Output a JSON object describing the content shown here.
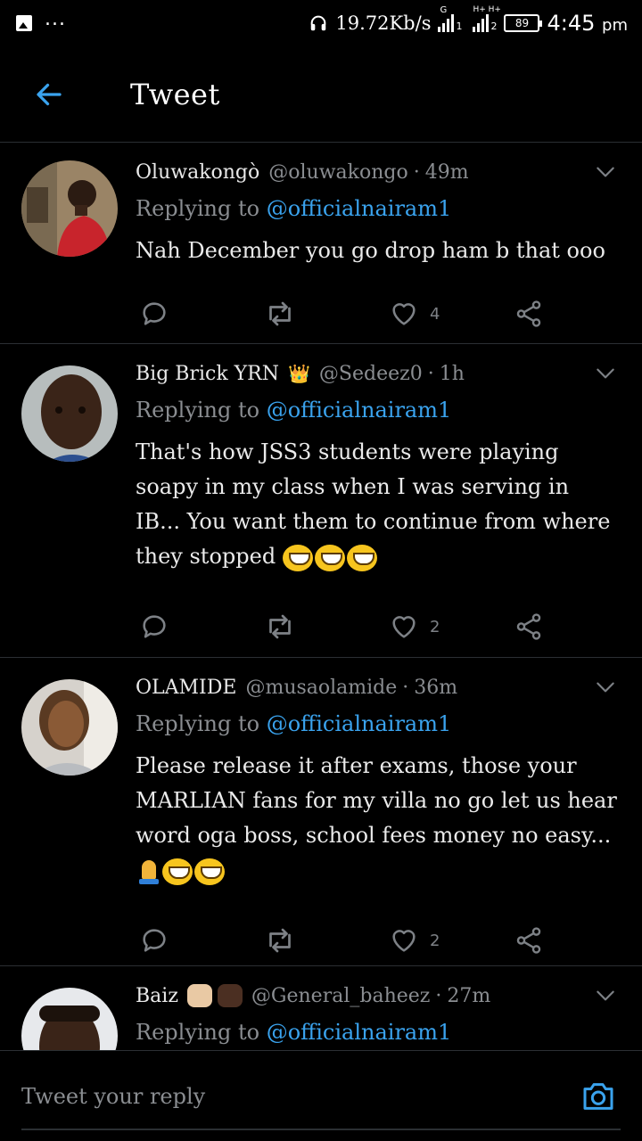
{
  "status_bar": {
    "net_speed": "19.72Kb/s",
    "sim1_label": "G",
    "sim1_index": "1",
    "sim2_label": "H+ H+",
    "sim2_index": "2",
    "battery": "89",
    "time": "4:45",
    "ampm": "pm",
    "icons": [
      "image-icon",
      "more-dots-icon",
      "headphones-icon",
      "signal-icon",
      "battery-icon"
    ]
  },
  "header": {
    "title": "Tweet",
    "back_icon": "arrow-left-icon"
  },
  "tweets": [
    {
      "name": "Oluwakongò",
      "name_emoji": "",
      "handle": "@oluwakongo",
      "time": "49m",
      "replying_prefix": "Replying to",
      "replying_handle": "@officialnairam1",
      "text": "Nah December you go drop ham b that ooo",
      "reply_count": "",
      "retweet_count": "",
      "like_count": "4"
    },
    {
      "name": "Big Brick YRN",
      "name_emoji": "👑",
      "handle": "@Sedeez0",
      "time": "1h",
      "replying_prefix": "Replying to",
      "replying_handle": "@officialnairam1",
      "text": "That's how JSS3 students were playing soapy in my class when I was serving in IB... You want them to continue from where they stopped",
      "text_emoji": "😂😂😂",
      "like_count": "2"
    },
    {
      "name": "OLAMIDE",
      "name_emoji": "",
      "handle": "@musaolamide",
      "time": "36m",
      "replying_prefix": "Replying to",
      "replying_handle": "@officialnairam1",
      "text": "Please release it after exams, those your MARLIAN fans for my villa no go let us hear word oga boss, school fees money no easy...",
      "text_emoji": "🙏😂😂",
      "like_count": "2"
    },
    {
      "name": "Baiz",
      "name_emoji": "✊🏻✊🏿",
      "handle": "@General_baheez",
      "time": "27m",
      "replying_prefix": "Replying to",
      "replying_handle": "@officialnairam1"
    }
  ],
  "reply_bar": {
    "placeholder": "Tweet your reply",
    "camera_icon": "camera-icon"
  },
  "colors": {
    "background": "#000000",
    "accent": "#3aa3ee",
    "muted": "#8a8d91",
    "divider": "#2b2f33"
  }
}
